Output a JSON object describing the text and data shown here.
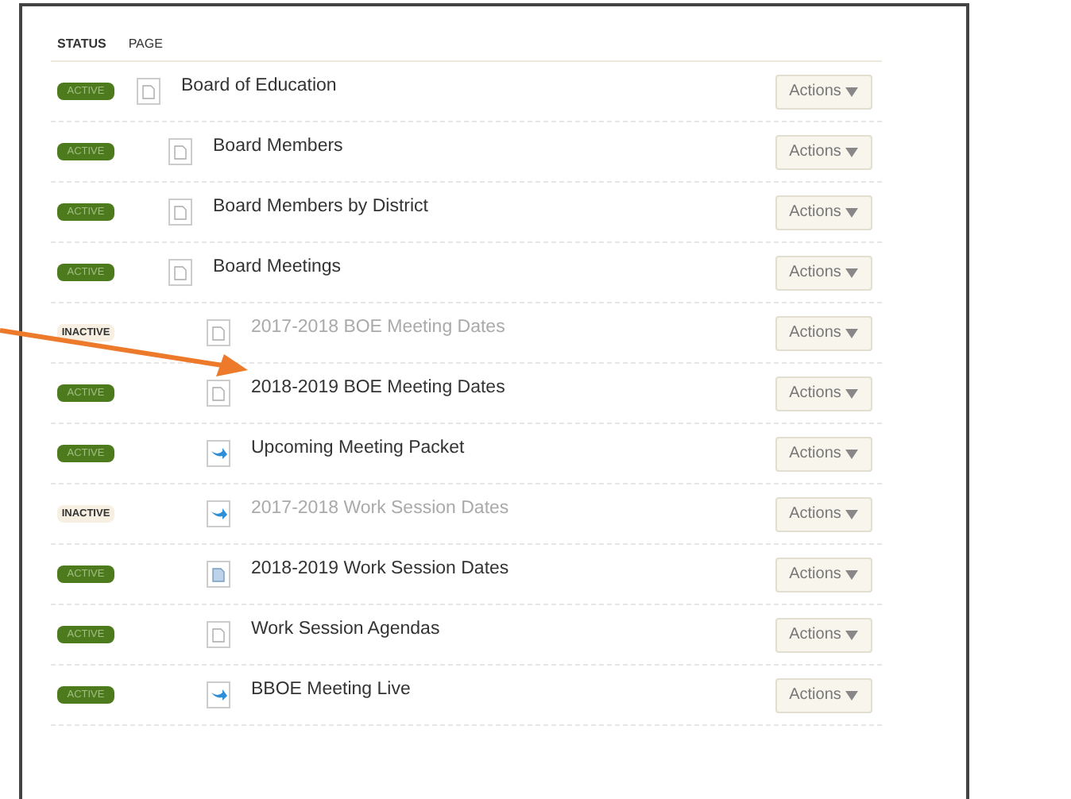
{
  "table": {
    "columns": [
      "STATUS",
      "PAGE"
    ],
    "rows": [
      {
        "status": "ACTIVE",
        "active": true,
        "kind": "page",
        "title": "Board of Education",
        "action": "Actions",
        "children": [
          {
            "status": "ACTIVE",
            "active": true,
            "kind": "page",
            "title": "Board Members",
            "action": "Actions"
          },
          {
            "status": "ACTIVE",
            "active": true,
            "kind": "page",
            "title": "Board Members by District",
            "action": "Actions"
          },
          {
            "status": "ACTIVE",
            "active": true,
            "kind": "page",
            "title": "Board Meetings",
            "action": "Actions",
            "children": [
              {
                "status": "INACTIVE",
                "active": false,
                "kind": "page",
                "title": "2017-2018 BOE Meeting Dates",
                "action": "Actions"
              },
              {
                "status": "ACTIVE",
                "active": true,
                "kind": "page",
                "title": "2018-2019 BOE Meeting Dates",
                "action": "Actions"
              },
              {
                "status": "ACTIVE",
                "active": true,
                "kind": "link",
                "title": "Upcoming Meeting Packet",
                "action": "Actions"
              },
              {
                "status": "INACTIVE",
                "active": false,
                "kind": "link",
                "title": "2017-2018 Work Session Dates",
                "action": "Actions"
              },
              {
                "status": "ACTIVE",
                "active": true,
                "kind": "file",
                "title": "2018-2019 Work Session Dates",
                "action": "Actions"
              },
              {
                "status": "ACTIVE",
                "active": true,
                "kind": "page",
                "title": "Work Session Agendas",
                "action": "Actions"
              },
              {
                "status": "ACTIVE",
                "active": true,
                "kind": "link",
                "title": "BBOE Meeting Live",
                "action": "Actions"
              }
            ]
          }
        ]
      }
    ]
  }
}
